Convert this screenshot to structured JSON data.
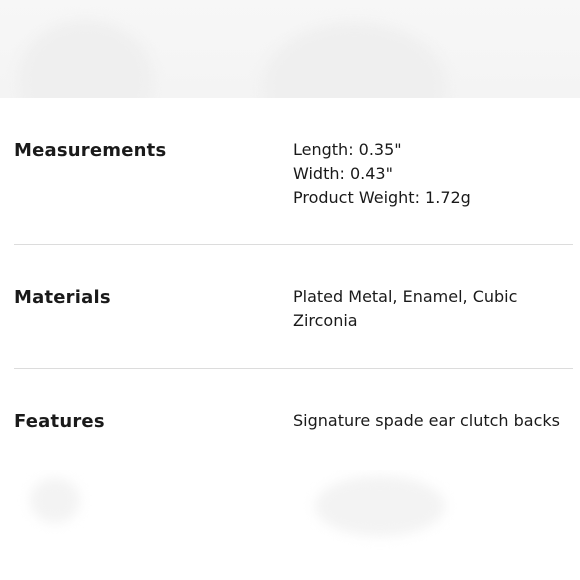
{
  "specs": [
    {
      "label": "Measurements",
      "values": [
        "Length: 0.35\"",
        "Width: 0.43\"",
        "Product Weight: 1.72g"
      ]
    },
    {
      "label": "Materials",
      "values": [
        "Plated Metal, Enamel, Cubic Zirconia"
      ]
    },
    {
      "label": "Features",
      "values": [
        "Signature spade ear clutch backs"
      ]
    }
  ]
}
